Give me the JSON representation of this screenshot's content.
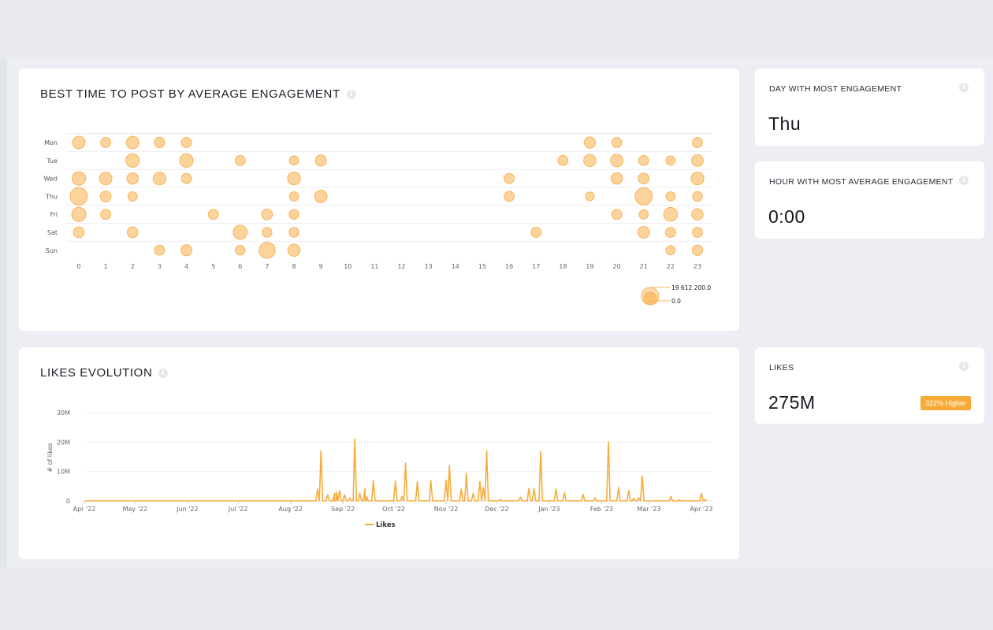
{
  "colors": {
    "accent": "#f9ab39",
    "bubble_fill": "#fcd39b",
    "bubble_stroke": "#f6b45a",
    "page_bg": "#e9eaef",
    "card_bg": "#ffffff"
  },
  "best_time_card": {
    "title": "BEST TIME TO POST BY AVERAGE ENGAGEMENT",
    "info_icon": "info-icon"
  },
  "likes_card": {
    "title": "LIKES EVOLUTION",
    "info_icon": "info-icon"
  },
  "stats": {
    "day": {
      "label": "DAY WITH MOST ENGAGEMENT",
      "value": "Thu",
      "info_icon": "info-icon"
    },
    "hour": {
      "label": "HOUR WITH MOST AVERAGE ENGAGEMENT",
      "value": "0:00",
      "info_icon": "info-icon"
    },
    "likes": {
      "label": "LIKES",
      "value": "275M",
      "badge": "322% Higher",
      "info_icon": "info-icon"
    }
  },
  "chart_data": [
    {
      "type": "scatter",
      "subtype": "bubble",
      "title": "BEST TIME TO POST BY AVERAGE ENGAGEMENT",
      "xlabel": "",
      "ylabel": "",
      "x_categories": [
        "0",
        "1",
        "2",
        "3",
        "4",
        "5",
        "6",
        "7",
        "8",
        "9",
        "10",
        "11",
        "12",
        "13",
        "14",
        "15",
        "16",
        "17",
        "18",
        "19",
        "20",
        "21",
        "22",
        "23"
      ],
      "y_categories": [
        "Mon",
        "Tue",
        "Wed",
        "Thu",
        "Fri",
        "Sat",
        "Sun"
      ],
      "size_legend": {
        "max_label": "19 612 200.0",
        "min_label": "0.0",
        "max_value": 19612200,
        "min_value": 0,
        "position": "bottom-right"
      },
      "grid": true,
      "points": [
        {
          "day": "Mon",
          "hour": 0,
          "value": 7500000
        },
        {
          "day": "Mon",
          "hour": 1,
          "value": 3500000
        },
        {
          "day": "Mon",
          "hour": 2,
          "value": 7500000
        },
        {
          "day": "Mon",
          "hour": 3,
          "value": 4000000
        },
        {
          "day": "Mon",
          "hour": 4,
          "value": 3500000
        },
        {
          "day": "Mon",
          "hour": 19,
          "value": 5000000
        },
        {
          "day": "Mon",
          "hour": 20,
          "value": 3500000
        },
        {
          "day": "Mon",
          "hour": 23,
          "value": 3500000
        },
        {
          "day": "Tue",
          "hour": 2,
          "value": 9500000
        },
        {
          "day": "Tue",
          "hour": 4,
          "value": 9500000
        },
        {
          "day": "Tue",
          "hour": 6,
          "value": 3500000
        },
        {
          "day": "Tue",
          "hour": 8,
          "value": 2500000
        },
        {
          "day": "Tue",
          "hour": 9,
          "value": 5000000
        },
        {
          "day": "Tue",
          "hour": 18,
          "value": 3500000
        },
        {
          "day": "Tue",
          "hour": 19,
          "value": 7000000
        },
        {
          "day": "Tue",
          "hour": 20,
          "value": 7500000
        },
        {
          "day": "Tue",
          "hour": 21,
          "value": 3500000
        },
        {
          "day": "Tue",
          "hour": 22,
          "value": 2500000
        },
        {
          "day": "Tue",
          "hour": 23,
          "value": 6000000
        },
        {
          "day": "Wed",
          "hour": 0,
          "value": 9500000
        },
        {
          "day": "Wed",
          "hour": 1,
          "value": 7500000
        },
        {
          "day": "Wed",
          "hour": 2,
          "value": 5500000
        },
        {
          "day": "Wed",
          "hour": 3,
          "value": 8000000
        },
        {
          "day": "Wed",
          "hour": 4,
          "value": 3500000
        },
        {
          "day": "Wed",
          "hour": 8,
          "value": 8000000
        },
        {
          "day": "Wed",
          "hour": 16,
          "value": 3500000
        },
        {
          "day": "Wed",
          "hour": 20,
          "value": 5500000
        },
        {
          "day": "Wed",
          "hour": 21,
          "value": 4500000
        },
        {
          "day": "Wed",
          "hour": 23,
          "value": 8000000
        },
        {
          "day": "Thu",
          "hour": 0,
          "value": 19612200
        },
        {
          "day": "Thu",
          "hour": 1,
          "value": 4500000
        },
        {
          "day": "Thu",
          "hour": 2,
          "value": 2500000
        },
        {
          "day": "Thu",
          "hour": 8,
          "value": 2500000
        },
        {
          "day": "Thu",
          "hour": 9,
          "value": 7500000
        },
        {
          "day": "Thu",
          "hour": 16,
          "value": 3500000
        },
        {
          "day": "Thu",
          "hour": 19,
          "value": 2000000
        },
        {
          "day": "Thu",
          "hour": 21,
          "value": 19000000
        },
        {
          "day": "Thu",
          "hour": 22,
          "value": 2500000
        },
        {
          "day": "Thu",
          "hour": 23,
          "value": 3000000
        },
        {
          "day": "Fri",
          "hour": 0,
          "value": 11000000
        },
        {
          "day": "Fri",
          "hour": 1,
          "value": 3500000
        },
        {
          "day": "Fri",
          "hour": 5,
          "value": 3500000
        },
        {
          "day": "Fri",
          "hour": 7,
          "value": 4500000
        },
        {
          "day": "Fri",
          "hour": 8,
          "value": 3000000
        },
        {
          "day": "Fri",
          "hour": 20,
          "value": 3500000
        },
        {
          "day": "Fri",
          "hour": 21,
          "value": 2500000
        },
        {
          "day": "Fri",
          "hour": 22,
          "value": 10000000
        },
        {
          "day": "Fri",
          "hour": 23,
          "value": 5500000
        },
        {
          "day": "Sat",
          "hour": 0,
          "value": 4500000
        },
        {
          "day": "Sat",
          "hour": 2,
          "value": 4500000
        },
        {
          "day": "Sat",
          "hour": 6,
          "value": 10500000
        },
        {
          "day": "Sat",
          "hour": 7,
          "value": 3000000
        },
        {
          "day": "Sat",
          "hour": 8,
          "value": 3000000
        },
        {
          "day": "Sat",
          "hour": 17,
          "value": 3500000
        },
        {
          "day": "Sat",
          "hour": 21,
          "value": 6000000
        },
        {
          "day": "Sat",
          "hour": 22,
          "value": 3500000
        },
        {
          "day": "Sat",
          "hour": 23,
          "value": 3500000
        },
        {
          "day": "Sun",
          "hour": 3,
          "value": 3500000
        },
        {
          "day": "Sun",
          "hour": 4,
          "value": 5000000
        },
        {
          "day": "Sun",
          "hour": 6,
          "value": 3000000
        },
        {
          "day": "Sun",
          "hour": 7,
          "value": 16000000
        },
        {
          "day": "Sun",
          "hour": 8,
          "value": 7000000
        },
        {
          "day": "Sun",
          "hour": 22,
          "value": 2500000
        },
        {
          "day": "Sun",
          "hour": 23,
          "value": 4000000
        }
      ]
    },
    {
      "type": "line",
      "title": "LIKES EVOLUTION",
      "xlabel": "",
      "ylabel": "# of likes",
      "x_start": "2022-04-01",
      "x_end": "2023-04-05",
      "x_tick_labels": [
        "Apr '22",
        "May '22",
        "Jun '22",
        "Jul '22",
        "Aug '22",
        "Sep '22",
        "Oct '22",
        "Nov '22",
        "Dec '22",
        "Jan '23",
        "Feb '23",
        "Mar '23",
        "Apr '23"
      ],
      "y_tick_labels": [
        "0",
        "10M",
        "20M",
        "30M"
      ],
      "ylim": [
        0,
        30000000
      ],
      "grid": true,
      "legend": {
        "position": "bottom",
        "entries": [
          "Likes"
        ]
      },
      "series": [
        {
          "name": "Likes",
          "baseline": 0,
          "peaks_day_offset_value": [
            [
              138,
              4000000
            ],
            [
              140,
              17000000
            ],
            [
              144,
              2000000
            ],
            [
              148,
              2500000
            ],
            [
              149,
              3000000
            ],
            [
              151,
              3500000
            ],
            [
              154,
              2000000
            ],
            [
              157,
              1000000
            ],
            [
              160,
              21000000
            ],
            [
              163,
              2500000
            ],
            [
              166,
              4000000
            ],
            [
              167,
              1500000
            ],
            [
              171,
              6800000
            ],
            [
              184,
              6700000
            ],
            [
              188,
              1500000
            ],
            [
              190,
              12800000
            ],
            [
              197,
              6500000
            ],
            [
              205,
              6800000
            ],
            [
              214,
              7000000
            ],
            [
              216,
              12000000
            ],
            [
              223,
              4000000
            ],
            [
              226,
              9300000
            ],
            [
              230,
              2500000
            ],
            [
              234,
              6500000
            ],
            [
              236,
              4500000
            ],
            [
              238,
              17000000
            ],
            [
              246,
              500000
            ],
            [
              258,
              1200000
            ],
            [
              263,
              4200000
            ],
            [
              266,
              4200000
            ],
            [
              270,
              16800000
            ],
            [
              279,
              4000000
            ],
            [
              284,
              2700000
            ],
            [
              295,
              2200000
            ],
            [
              302,
              1000000
            ],
            [
              310,
              20000000
            ],
            [
              316,
              4500000
            ],
            [
              322,
              3500000
            ],
            [
              325,
              800000
            ],
            [
              328,
              1000000
            ],
            [
              330,
              8500000
            ],
            [
              347,
              1500000
            ],
            [
              352,
              300000
            ],
            [
              365,
              2500000
            ],
            [
              367,
              500000
            ]
          ]
        }
      ]
    }
  ]
}
